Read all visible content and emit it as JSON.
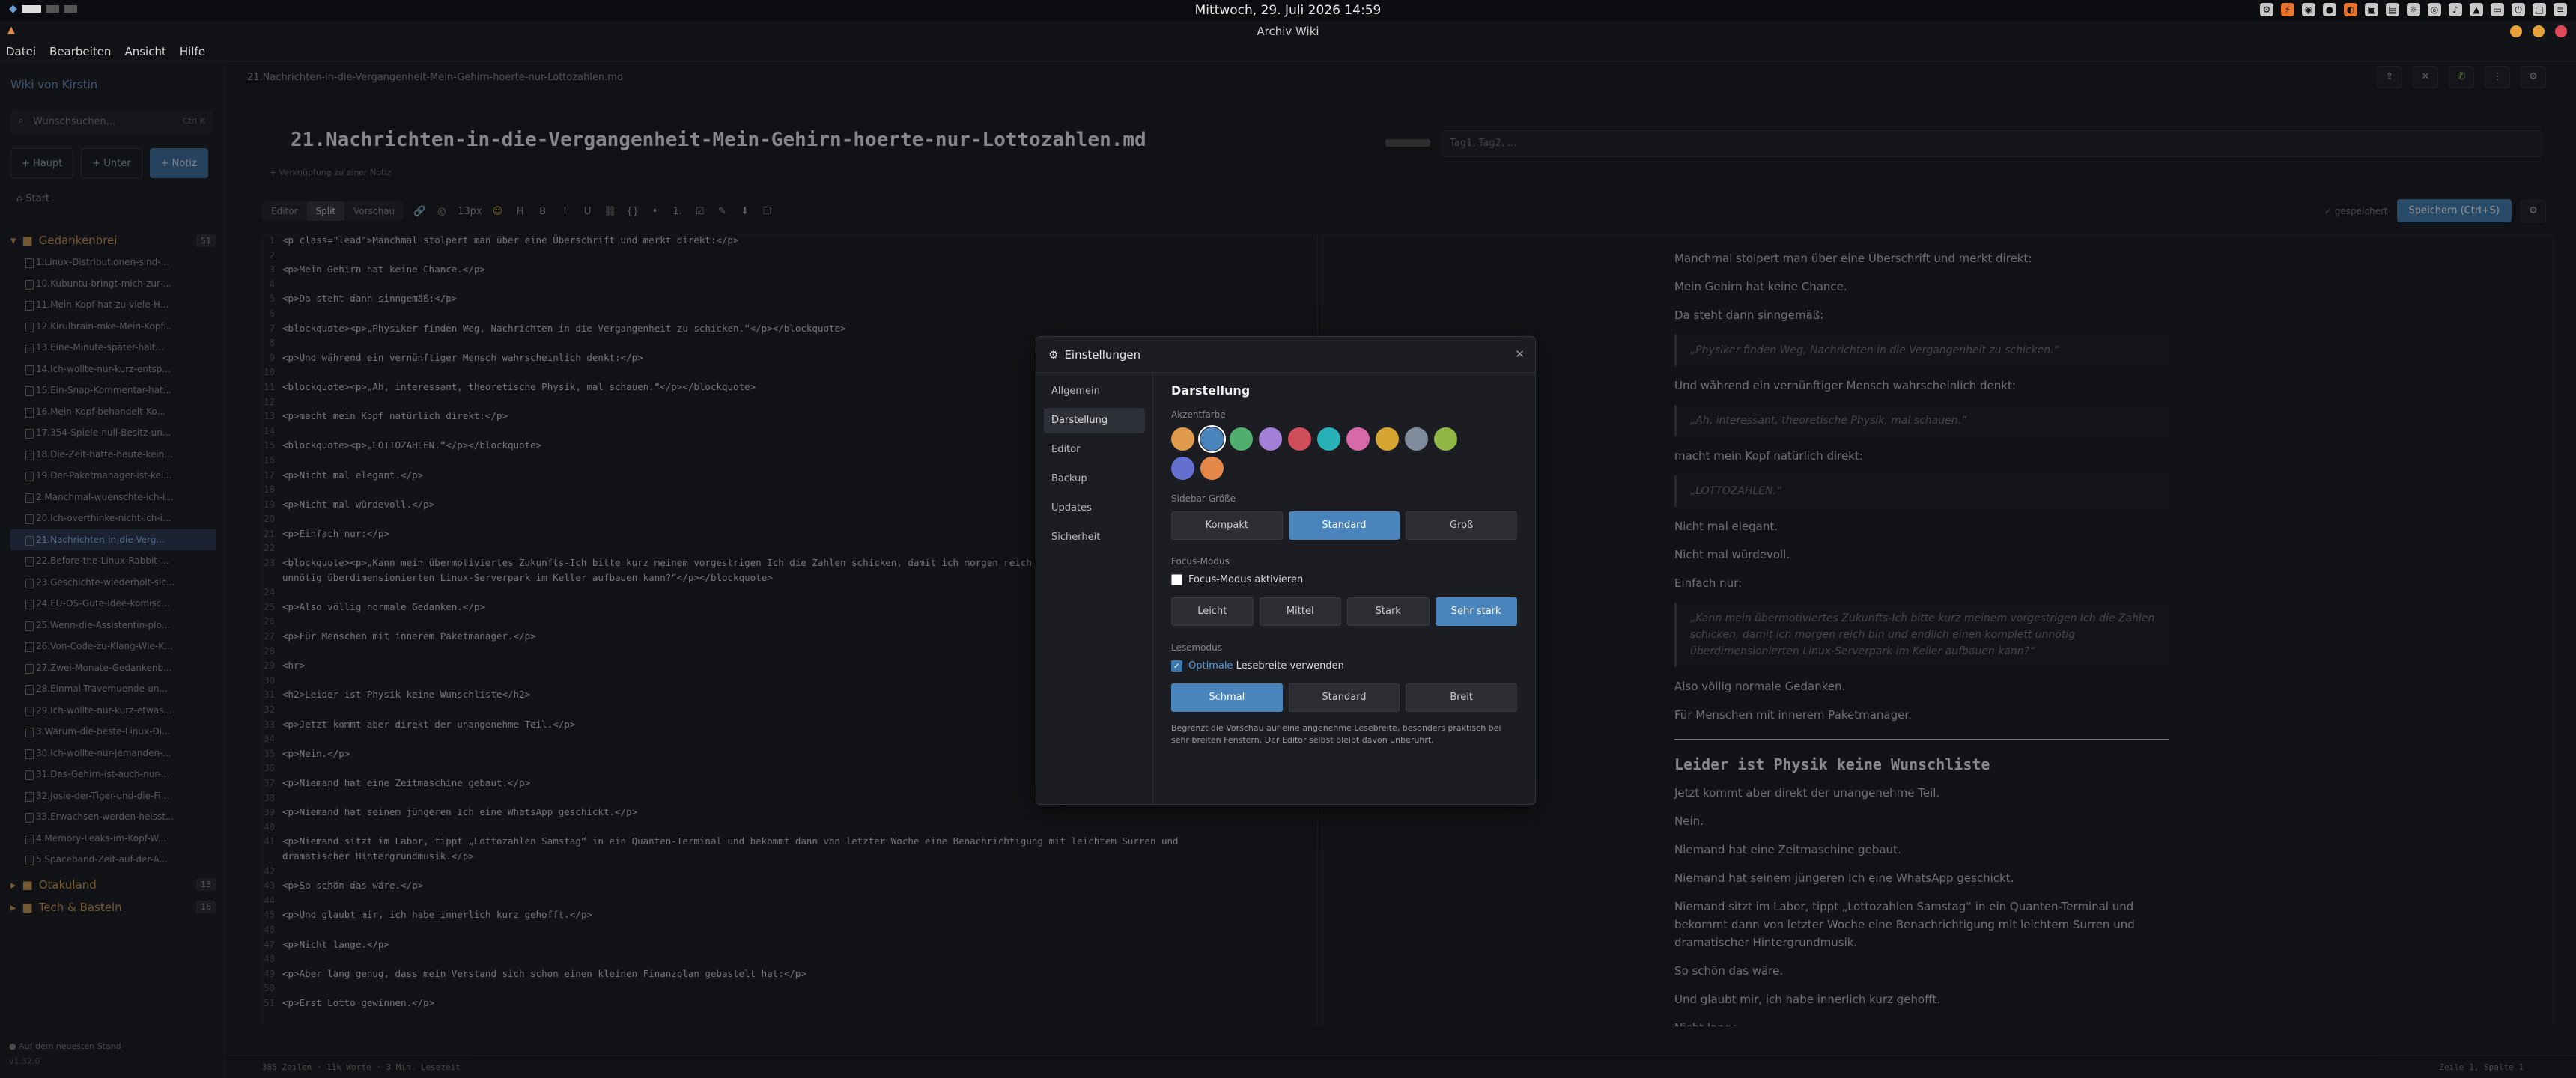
{
  "system": {
    "clock": "Mittwoch, 29. Juli 2026 14:59"
  },
  "window": {
    "title": "Archiv Wiki"
  },
  "menu": [
    "Datei",
    "Bearbeiten",
    "Ansicht",
    "Hilfe"
  ],
  "sidebar": {
    "title": "Wiki von Kirstin",
    "search_placeholder": "Wunschsuchen...",
    "search_shortcut": "Ctrl K",
    "btn_haupt": "+ Haupt",
    "btn_unter": "+ Unter",
    "btn_notiz": "+ Notiz",
    "start": "Start",
    "folders": [
      {
        "name": "Gedankenbrei",
        "count": "51"
      },
      {
        "name": "Otakuland",
        "count": "13"
      },
      {
        "name": "Tech & Basteln",
        "count": "16"
      }
    ],
    "files": [
      "1.Linux-Distributionen-sind-...",
      "10.Kubuntu-bringt-mich-zur-...",
      "11.Mein-Kopf-hat-zu-viele-H...",
      "12.Kirulbrain-mke-Mein-Kopf...",
      "13.Eine-Minute-später-halt...",
      "14.Ich-wollte-nur-kurz-entsp...",
      "15.Ein-Snap-Kommentar-hat...",
      "16.Mein-Kopf-behandelt-Ko...",
      "17.354-Spiele-null-Besitz-un...",
      "18.Die-Zeit-hatte-heute-kein...",
      "19.Der-Paketmanager-ist-kei...",
      "2.Manchmal-wuenschte-ich-i...",
      "20.Ich-overthinke-nicht-ich-i...",
      "21.Nachrichten-in-die-Verg...",
      "22.Before-the-Linux-Rabbit-...",
      "23.Geschichte-wiederholt-sic...",
      "24.EU-OS-Gute-Idee-komisc...",
      "25.Wenn-die-Assistentin-plo...",
      "26.Von-Code-zu-Klang-Wie-K...",
      "27.Zwei-Monate-Gedankenb...",
      "28.Einmal-Travemuende-un...",
      "29.Ich-wollte-nur-kurz-etwas...",
      "3.Warum-die-beste-Linux-Di...",
      "30.Ich-wollte-nur-jemanden-...",
      "31.Das-Gehirn-ist-auch-nur-...",
      "32.Josie-der-Tiger-und-die-Fi...",
      "33.Erwachsen-werden-heisst...",
      "4.Memory-Leaks-im-Kopf-W...",
      "5.Spaceband-Zeit-auf-der-A..."
    ],
    "footer": "Auf dem neuesten Stand",
    "version": "v1.32.0"
  },
  "doc": {
    "path": "21.Nachrichten-in-die-Vergangenheit-Mein-Gehirn-hoerte-nur-Lottozahlen.md",
    "title": "21.Nachrichten-in-die-Vergangenheit-Mein-Gehirn-hoerte-nur-Lottozahlen.md",
    "tags_placeholder": "Tag1, Tag2, ...",
    "link_line": "+ Verknüpfung zu einer Notiz",
    "modes": [
      "Editor",
      "Split",
      "Vorschau"
    ],
    "fontsize": "13px",
    "saved": "✓ gespeichert",
    "save_button": "Speichern (Ctrl+S)"
  },
  "editor_lines": [
    [
      "1",
      "<p class=\"lead\">Manchmal stolpert man über eine Überschrift und merkt direkt:</p>"
    ],
    [
      "2",
      ""
    ],
    [
      "3",
      "<p>Mein Gehirn hat keine Chance.</p>"
    ],
    [
      "4",
      ""
    ],
    [
      "5",
      "<p>Da steht dann sinngemäß:</p>"
    ],
    [
      "6",
      ""
    ],
    [
      "7",
      "<blockquote><p>„Physiker finden Weg, Nachrichten in die Vergangenheit zu schicken.“</p></blockquote>"
    ],
    [
      "8",
      ""
    ],
    [
      "9",
      "<p>Und während ein vernünftiger Mensch wahrscheinlich denkt:</p>"
    ],
    [
      "10",
      ""
    ],
    [
      "11",
      "<blockquote><p>„Ah, interessant, theoretische Physik, mal schauen.“</p></blockquote>"
    ],
    [
      "12",
      ""
    ],
    [
      "13",
      "<p>macht mein Kopf natürlich direkt:</p>"
    ],
    [
      "14",
      ""
    ],
    [
      "15",
      "<blockquote><p>„LOTTOZAHLEN.“</p></blockquote>"
    ],
    [
      "16",
      ""
    ],
    [
      "17",
      "<p>Nicht mal elegant.</p>"
    ],
    [
      "18",
      ""
    ],
    [
      "19",
      "<p>Nicht mal würdevoll.</p>"
    ],
    [
      "20",
      ""
    ],
    [
      "21",
      "<p>Einfach nur:</p>"
    ],
    [
      "22",
      ""
    ],
    [
      "23",
      "<blockquote><p>„Kann mein übermotiviertes Zukunfts-Ich bitte kurz meinem vorgestrigen Ich die Zahlen schicken, damit ich morgen reich bin und endlich einen komplett"
    ],
    [
      "",
      "unnötig überdimensionierten Linux-Serverpark im Keller aufbauen kann?“</p></blockquote>"
    ],
    [
      "24",
      ""
    ],
    [
      "25",
      "<p>Also völlig normale Gedanken.</p>"
    ],
    [
      "26",
      ""
    ],
    [
      "27",
      "<p>Für Menschen mit innerem Paketmanager.</p>"
    ],
    [
      "28",
      ""
    ],
    [
      "29",
      "<hr>"
    ],
    [
      "30",
      ""
    ],
    [
      "31",
      "<h2>Leider ist Physik keine Wunschliste</h2>"
    ],
    [
      "32",
      ""
    ],
    [
      "33",
      "<p>Jetzt kommt aber direkt der unangenehme Teil.</p>"
    ],
    [
      "34",
      ""
    ],
    [
      "35",
      "<p>Nein.</p>"
    ],
    [
      "36",
      ""
    ],
    [
      "37",
      "<p>Niemand hat eine Zeitmaschine gebaut.</p>"
    ],
    [
      "38",
      ""
    ],
    [
      "39",
      "<p>Niemand hat seinem jüngeren Ich eine WhatsApp geschickt.</p>"
    ],
    [
      "40",
      ""
    ],
    [
      "41",
      "<p>Niemand sitzt im Labor, tippt „Lottozahlen Samstag“ in ein Quanten-Terminal und bekommt dann von letzter Woche eine Benachrichtigung mit leichtem Surren und"
    ],
    [
      "",
      "dramatischer Hintergrundmusik.</p>"
    ],
    [
      "42",
      ""
    ],
    [
      "43",
      "<p>So schön das wäre.</p>"
    ],
    [
      "44",
      ""
    ],
    [
      "45",
      "<p>Und glaubt mir, ich habe innerlich kurz gehofft.</p>"
    ],
    [
      "46",
      ""
    ],
    [
      "47",
      "<p>Nicht lange.</p>"
    ],
    [
      "48",
      ""
    ],
    [
      "49",
      "<p>Aber lang genug, dass mein Verstand sich schon einen kleinen Finanzplan gebastelt hat:</p>"
    ],
    [
      "50",
      ""
    ],
    [
      "51",
      "<p>Erst Lotto gewinnen.</p>"
    ]
  ],
  "preview": {
    "p1": "Manchmal stolpert man über eine Überschrift und merkt direkt:",
    "p2": "Mein Gehirn hat keine Chance.",
    "p3": "Da steht dann sinngemäß:",
    "q1": "„Physiker finden Weg, Nachrichten in die Vergangenheit zu schicken.“",
    "p4": "Und während ein vernünftiger Mensch wahrscheinlich denkt:",
    "q2": "„Ah, interessant, theoretische Physik, mal schauen.“",
    "p5": "macht mein Kopf natürlich direkt:",
    "q3": "„LOTTOZAHLEN.“",
    "p6": "Nicht mal elegant.",
    "p7": "Nicht mal würdevoll.",
    "p8": "Einfach nur:",
    "q4": "„Kann mein übermotiviertes Zukunfts-Ich bitte kurz meinem vorgestrigen Ich die Zahlen schicken, damit ich morgen reich bin und endlich einen komplett unnötig überdimensionierten Linux-Serverpark im Keller aufbauen kann?“",
    "p9": "Also völlig normale Gedanken.",
    "p10": "Für Menschen mit innerem Paketmanager.",
    "h2": "Leider ist Physik keine Wunschliste",
    "p11": "Jetzt kommt aber direkt der unangenehme Teil.",
    "p12": "Nein.",
    "p13": "Niemand hat eine Zeitmaschine gebaut.",
    "p14": "Niemand hat seinem jüngeren Ich eine WhatsApp geschickt.",
    "p15": "Niemand sitzt im Labor, tippt „Lottozahlen Samstag“ in ein Quanten-Terminal und bekommt dann von letzter Woche eine Benachrichtigung mit leichtem Surren und dramatischer Hintergrundmusik.",
    "p16": "So schön das wäre.",
    "p17": "Und glaubt mir, ich habe innerlich kurz gehofft.",
    "p18": "Nicht lange."
  },
  "status": {
    "left": "385 Zeilen · 11k Worte · 3 Min. Lesezeit",
    "right": "Zeile 1, Spalte 1"
  },
  "settings": {
    "title": "Einstellungen",
    "nav": [
      "Allgemein",
      "Darstellung",
      "Editor",
      "Backup",
      "Updates",
      "Sicherheit"
    ],
    "section": "Darstellung",
    "accent_label": "Akzentfarbe",
    "accent_colors": [
      "#e09a4c",
      "#4a84bc",
      "#4fae6e",
      "#a37ed6",
      "#d04e5a",
      "#27b0b8",
      "#d66aa8",
      "#d6a430",
      "#7f8a9a",
      "#8fb545",
      "#6470d0",
      "#e4884a"
    ],
    "sidebar_label": "Sidebar-Größe",
    "sidebar_opts": [
      "Kompakt",
      "Standard",
      "Groß"
    ],
    "focus_label": "Focus-Modus",
    "focus_check": "Focus-Modus aktivieren",
    "focus_opts": [
      "Leicht",
      "Mittel",
      "Stark",
      "Sehr stark"
    ],
    "read_label": "Lesemodus",
    "read_check_hl": "Optimale",
    "read_check": " Lesebreite verwenden",
    "read_opts": [
      "Schmal",
      "Standard",
      "Breit"
    ],
    "hint": "Begrenzt die Vorschau auf eine angenehme Lesebreite, besonders praktisch bei sehr breiten Fenstern. Der Editor selbst bleibt davon unberührt."
  }
}
